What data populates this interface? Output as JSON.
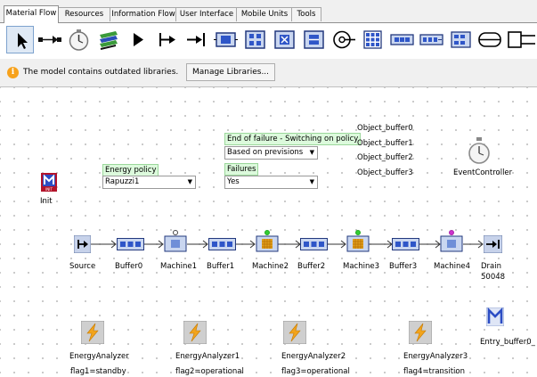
{
  "tabs": [
    "Material Flow",
    "Resources",
    "Information Flow",
    "User Interface",
    "Mobile Units",
    "Tools"
  ],
  "info_bar": {
    "message": "The model contains outdated libraries.",
    "button_label": "Manage Libraries..."
  },
  "toolbar": {
    "icons": [
      "pointer-icon",
      "connector-icon",
      "event-controller-icon",
      "source-icon",
      "drain-icon",
      "single-proc-icon",
      "parallel-proc-icon",
      "assembly-icon",
      "dismantle-icon",
      "shift-icon",
      "store-icon",
      "buffer-icon",
      "placebuffer-icon",
      "sorter-icon",
      "cycle-icon",
      "track-icon"
    ]
  },
  "canvas": {
    "init_label": "Init",
    "energy_policy_label": "Energy policy",
    "energy_policy_value": "Rapuzzi1",
    "end_of_failure_label": "End of failure - Switching on policy",
    "end_of_failure_value": "Based on previsions",
    "failures_label": "Failures",
    "failures_value": "Yes",
    "object_buffers": [
      "Object_buffer0",
      "Object_buffer1",
      "Object_buffer2",
      "Object_buffer3"
    ],
    "event_controller_label": "EventController",
    "flow": [
      {
        "name": "Source",
        "type": "source"
      },
      {
        "name": "Buffer0",
        "type": "buffer"
      },
      {
        "name": "Machine1",
        "type": "machine"
      },
      {
        "name": "Buffer1",
        "type": "buffer"
      },
      {
        "name": "Machine2",
        "type": "machine"
      },
      {
        "name": "Buffer2",
        "type": "buffer"
      },
      {
        "name": "Machine3",
        "type": "machine"
      },
      {
        "name": "Buffer3",
        "type": "buffer"
      },
      {
        "name": "Machine4",
        "type": "machine"
      },
      {
        "name": "Drain",
        "type": "drain"
      }
    ],
    "drain_count": "50048",
    "energy_analyzers": [
      {
        "name": "EnergyAnalyzer",
        "flag": "flag1=standby"
      },
      {
        "name": "EnergyAnalyzer1",
        "flag": "flag2=operational"
      },
      {
        "name": "EnergyAnalyzer2",
        "flag": "flag3=operational"
      },
      {
        "name": "EnergyAnalyzer3",
        "flag": "flag4=transition"
      }
    ],
    "entry_buffer_label": "Entry_buffer0_"
  },
  "colors": {
    "machine_indicators": [
      "#ffffff",
      "#33cc33",
      "#33cc33",
      "#cc33cc"
    ],
    "green_label_bg": "#dcfadc",
    "selected_tool": "#dfe9f5"
  }
}
